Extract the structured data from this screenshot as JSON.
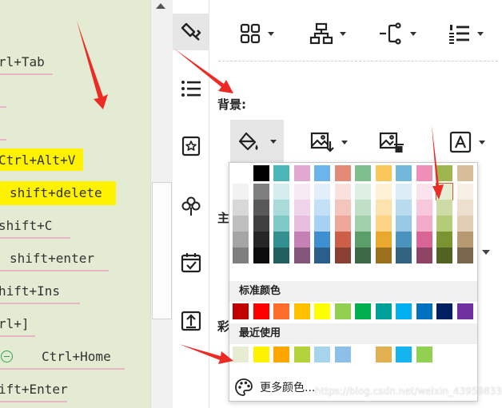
{
  "canvas": {
    "nodes": [
      {
        "text": "rl+Tab"
      },
      {
        "text": "Ctrl+Alt+V"
      },
      {
        "text": "shift+delete"
      },
      {
        "text": "shift+C"
      },
      {
        "text": "shift+enter"
      },
      {
        "text": "hift+Ins"
      },
      {
        "text": "rl+]"
      },
      {
        "text": "Ctrl+Home"
      },
      {
        "text": "ift+Enter"
      }
    ],
    "highlight_color": "#fff200",
    "background": "#e3ecd3"
  },
  "side_tools": [
    {
      "icon": "paint-brush-icon",
      "active": true
    },
    {
      "icon": "list-icon",
      "active": false
    },
    {
      "icon": "star-badge-icon",
      "active": false
    },
    {
      "icon": "clover-icon",
      "active": false
    },
    {
      "icon": "calendar-check-icon",
      "active": false
    },
    {
      "icon": "upload-box-icon",
      "active": false
    }
  ],
  "toolbar": [
    {
      "icon": "grid-layout-icon"
    },
    {
      "icon": "org-chart-icon"
    },
    {
      "icon": "connector-icon"
    },
    {
      "icon": "numbered-list-icon"
    }
  ],
  "background_section": {
    "label": "背景:",
    "buttons": [
      {
        "icon": "paint-bucket-icon"
      },
      {
        "icon": "image-insert-icon"
      },
      {
        "icon": "image-delete-icon"
      },
      {
        "icon": "text-frame-icon"
      }
    ]
  },
  "panel_labels": {
    "main": "主",
    "color": "彩"
  },
  "color_picker": {
    "theme_grid": [
      [
        "#ffffff",
        "#000000",
        "#4cb6b6",
        "#e1a8d2",
        "#6cb4ec",
        "#e68a78",
        "#7fbf8e",
        "#f9c75c",
        "#74b7dd",
        "#ef8fb8",
        "#9db64e",
        "#d8bd99"
      ],
      [
        "#f2f2f2",
        "#7f7f7f",
        "#d4eded",
        "#f8eaf4",
        "#e1effb",
        "#f9e2dd",
        "#dfefe3",
        "#fef1d6",
        "#dcedf6",
        "#fbe3ed",
        "#e6edd3",
        "#f5efe6"
      ],
      [
        "#d8d8d8",
        "#595959",
        "#aadbdb",
        "#f0d4e9",
        "#c4e0f7",
        "#f4c5bb",
        "#c0dfc7",
        "#fce3ae",
        "#b9dbee",
        "#f7c7db",
        "#cddca7",
        "#ecdfcd"
      ],
      [
        "#bfbfbf",
        "#3f3f3f",
        "#80c9c9",
        "#e8bede",
        "#a7d1f3",
        "#eea799",
        "#a0cfab",
        "#fbd585",
        "#97c9e5",
        "#f3abc9",
        "#b4cb7a",
        "#e2cfb3"
      ],
      [
        "#a5a5a5",
        "#262626",
        "#349090",
        "#c681b4",
        "#3e8fd1",
        "#cd5f49",
        "#5a9e6a",
        "#e9a92e",
        "#4a93bf",
        "#d86596",
        "#7b9432",
        "#b79a72"
      ],
      [
        "#7f7f7f",
        "#0c0c0c",
        "#226060",
        "#84567a",
        "#2a5f8b",
        "#893f31",
        "#3c6947",
        "#9b711e",
        "#316280",
        "#904364",
        "#526321",
        "#7a664c"
      ]
    ],
    "selected": "#e6edd3",
    "standard_title": "标准颜色",
    "standard_colors": [
      "#c00000",
      "#ff0000",
      "#ff6d2d",
      "#ffc000",
      "#ffff00",
      "#92d050",
      "#00b050",
      "#00a09a",
      "#00b0f0",
      "#0070c0",
      "#002060",
      "#7030a0"
    ],
    "recent_title": "最近使用",
    "recent_colors": [
      "#e6edd3",
      "#fff200",
      "#ffa500",
      "#b4d23c",
      "#a5d4ec",
      "#8cc0e9",
      "#ffffff",
      "#e1b050",
      "#14b4f0",
      "#92d050"
    ],
    "more_label": "更多颜色...",
    "more_icon": "palette-icon"
  },
  "watermark": "https://blog.csdn.net/weixin_43959833",
  "annotation_color": "#ee2a24"
}
